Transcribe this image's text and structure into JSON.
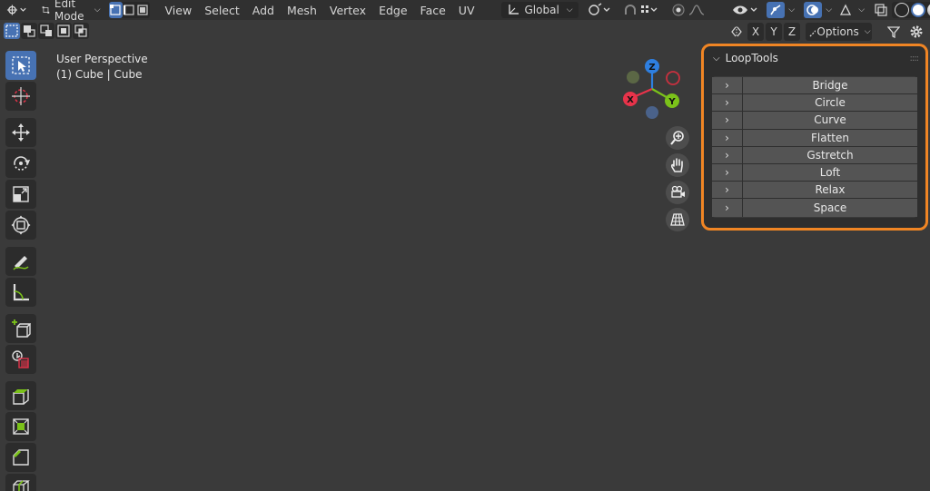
{
  "header": {
    "mode_label": "Edit Mode",
    "menus": [
      "View",
      "Select",
      "Add",
      "Mesh",
      "Vertex",
      "Edge",
      "Face",
      "UV"
    ],
    "orientation_label": "Global"
  },
  "tool_settings": {
    "axis_x": "X",
    "axis_y": "Y",
    "axis_z": "Z",
    "options_label": "Options"
  },
  "viewport": {
    "perspective_label": "User Perspective",
    "object_label": "(1) Cube | Cube"
  },
  "gizmo": {
    "x_label": "X",
    "y_label": "Y",
    "z_label": "Z"
  },
  "looptools": {
    "title": "LoopTools",
    "items": [
      "Bridge",
      "Circle",
      "Curve",
      "Flatten",
      "Gstretch",
      "Loft",
      "Relax",
      "Space"
    ]
  },
  "colors": {
    "accent": "#4772b3",
    "highlight_border": "#f08524",
    "selected_face": "#e8a25a",
    "axis_x": "#e8334a",
    "axis_y": "#7bc21a",
    "axis_z": "#2e7fe0"
  },
  "icons": [
    "editor-type-icon",
    "object-mode-icon",
    "vertex-select-icon",
    "edge-select-icon",
    "face-select-icon",
    "transform-orientation-icon",
    "pivot-icon",
    "snap-icon",
    "proportional-icon",
    "visibility-icon",
    "gizmo-icon",
    "overlay-icon",
    "xray-icon",
    "filter-icon",
    "gear-icon",
    "select-box-icon",
    "cursor-icon",
    "move-icon",
    "rotate-icon",
    "scale-icon",
    "transform-icon",
    "annotate-icon",
    "measure-icon",
    "add-cube-icon",
    "extrude-icon",
    "inset-icon",
    "bevel-icon",
    "loop-cut-icon",
    "zoom-icon",
    "pan-hand-icon",
    "camera-icon",
    "ortho-grid-icon"
  ]
}
